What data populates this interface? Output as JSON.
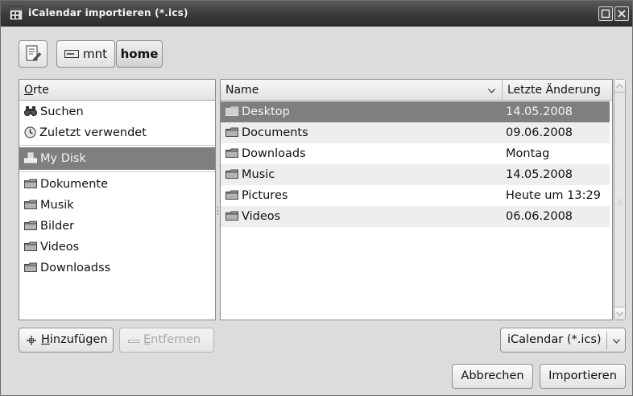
{
  "window": {
    "title": "iCalendar importieren (*.ics)"
  },
  "pathbar": {
    "segments": [
      "mnt",
      "home"
    ],
    "active": "home"
  },
  "places": {
    "header_first": "O",
    "header_rest": "rte",
    "items": [
      {
        "label": "Suchen",
        "icon": "binoculars-icon"
      },
      {
        "label": "Zuletzt verwendet",
        "icon": "clock-icon"
      },
      {
        "label": "My Disk",
        "icon": "drive-icon",
        "selected": true
      },
      {
        "label": "Dokumente",
        "icon": "folder-icon"
      },
      {
        "label": "Musik",
        "icon": "folder-icon"
      },
      {
        "label": "Bilder",
        "icon": "folder-icon"
      },
      {
        "label": "Videos",
        "icon": "folder-icon"
      },
      {
        "label": "Downloadss",
        "icon": "folder-icon"
      }
    ]
  },
  "files": {
    "col_name": "Name",
    "col_modified": "Letzte Änderung",
    "rows": [
      {
        "name": "Desktop",
        "modified": "14.05.2008",
        "selected": true
      },
      {
        "name": "Documents",
        "modified": "09.06.2008"
      },
      {
        "name": "Downloads",
        "modified": "Montag"
      },
      {
        "name": "Music",
        "modified": "14.05.2008"
      },
      {
        "name": "Pictures",
        "modified": "Heute um 13:29"
      },
      {
        "name": "Videos",
        "modified": "06.06.2008"
      }
    ]
  },
  "buttons": {
    "add_first": "H",
    "add_rest": "inzufügen",
    "remove_first": "E",
    "remove_rest": "ntfernen",
    "filter": "iCalendar (*.ics)",
    "cancel": "Abbrechen",
    "import": "Importieren"
  },
  "colors": {
    "selection": "#7f7f7f",
    "window_bg": "#dcdcdc",
    "titlebar": "#3a3a3a"
  }
}
